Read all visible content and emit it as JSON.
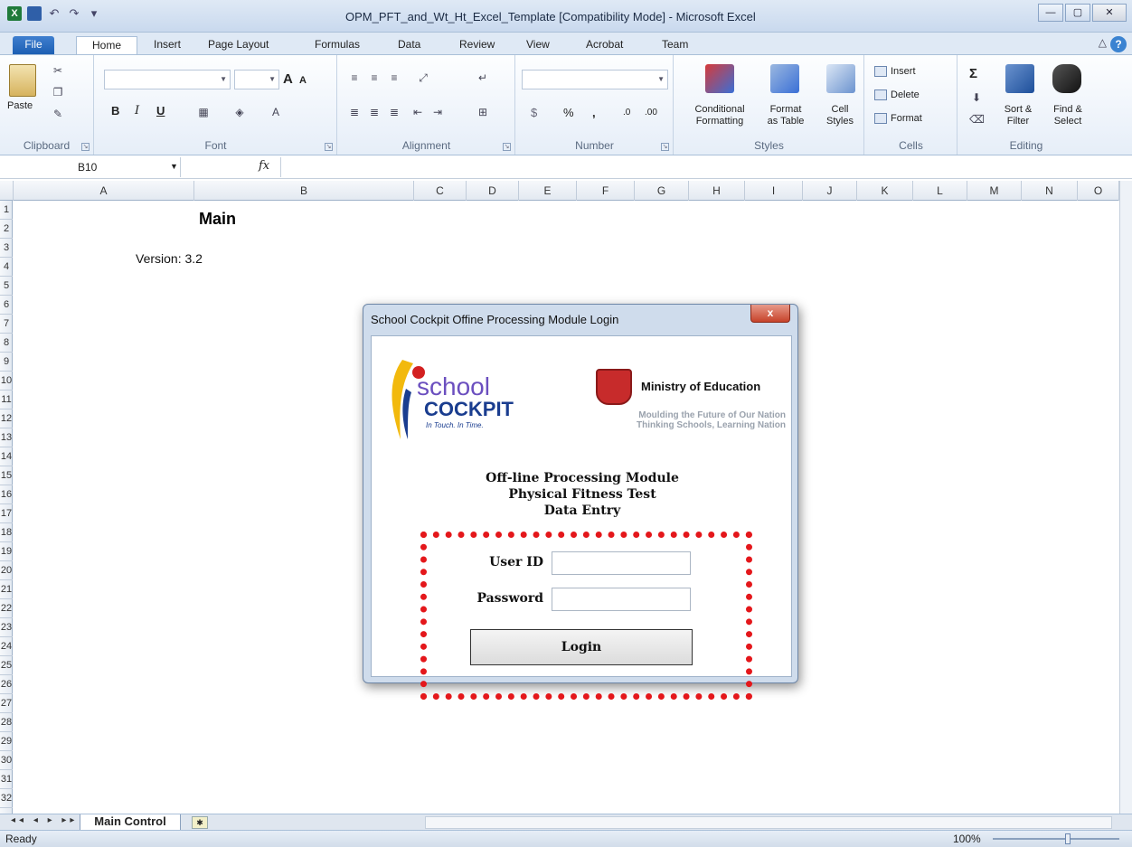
{
  "window": {
    "title": "OPM_PFT_and_Wt_Ht_Excel_Template  [Compatibility Mode]  -  Microsoft Excel",
    "controls": {
      "minimize": "—",
      "maximize": "▢",
      "close": "✕"
    }
  },
  "quick_access": {
    "undo": "↶",
    "redo": "↷",
    "customize": "▾"
  },
  "ribbon_tabs": [
    "File",
    "Home",
    "Insert",
    "Page Layout",
    "Formulas",
    "Data",
    "Review",
    "View",
    "Acrobat",
    "Team"
  ],
  "ribbon": {
    "clipboard": {
      "paste": "Paste",
      "label": "Clipboard"
    },
    "font": {
      "bold": "B",
      "italic": "I",
      "underline": "U",
      "grow": "A",
      "shrink": "A",
      "label": "Font"
    },
    "alignment": {
      "label": "Alignment"
    },
    "number": {
      "currency": "$",
      "percent": "%",
      "comma": ",",
      "inc": ".0",
      "dec": ".00",
      "label": "Number"
    },
    "styles": {
      "conditional": "Conditional",
      "conditional2": "Formatting",
      "format_table": "Format",
      "format_table2": "as Table",
      "cell_styles": "Cell",
      "cell_styles2": "Styles",
      "label": "Styles"
    },
    "cells": {
      "insert": "Insert",
      "delete": "Delete",
      "format": "Format",
      "label": "Cells"
    },
    "editing": {
      "sum": "Σ",
      "sort": "Sort &",
      "sort2": "Filter",
      "find": "Find &",
      "find2": "Select",
      "label": "Editing"
    }
  },
  "formula_bar": {
    "name_box": "B10",
    "fx": "fx",
    "value": ""
  },
  "columns": [
    "A",
    "B",
    "C",
    "D",
    "E",
    "F",
    "G",
    "H",
    "I",
    "J",
    "K",
    "L",
    "M",
    "N",
    "O"
  ],
  "rows": [
    "1",
    "2",
    "3",
    "4",
    "5",
    "6",
    "7",
    "8",
    "9",
    "10",
    "11",
    "12",
    "13",
    "14",
    "15",
    "16",
    "17",
    "18",
    "19",
    "20",
    "21",
    "22",
    "23",
    "24",
    "25",
    "26",
    "27",
    "28",
    "29",
    "30",
    "31",
    "32"
  ],
  "sheet": {
    "title": "Main",
    "version": "Version:  3.2"
  },
  "sheet_tabs": {
    "nav": "◂◂ ◂ ▸ ▸▸",
    "active": "Main Control"
  },
  "status": {
    "ready": "Ready",
    "zoom": "100%"
  },
  "dialog": {
    "title": "School Cockpit Offine Processing Module Login",
    "close": "x",
    "logo_school": "school",
    "logo_cockpit": "COCKPIT",
    "logo_tagline": "In Touch. In Time.",
    "moe_title": "Ministry of Education",
    "moe_line1": "Moulding the Future of Our Nation",
    "moe_line2": "Thinking Schools, Learning Nation",
    "heading1": "Off-line Processing Module",
    "heading2": "Physical Fitness Test",
    "heading3": "Data Entry",
    "user_label": "User ID",
    "user_value": "",
    "password_label": "Password",
    "password_value": "",
    "login_button": "Login"
  },
  "colors": {
    "highlight": "#e4171b",
    "accent": "#1d5fb3"
  }
}
